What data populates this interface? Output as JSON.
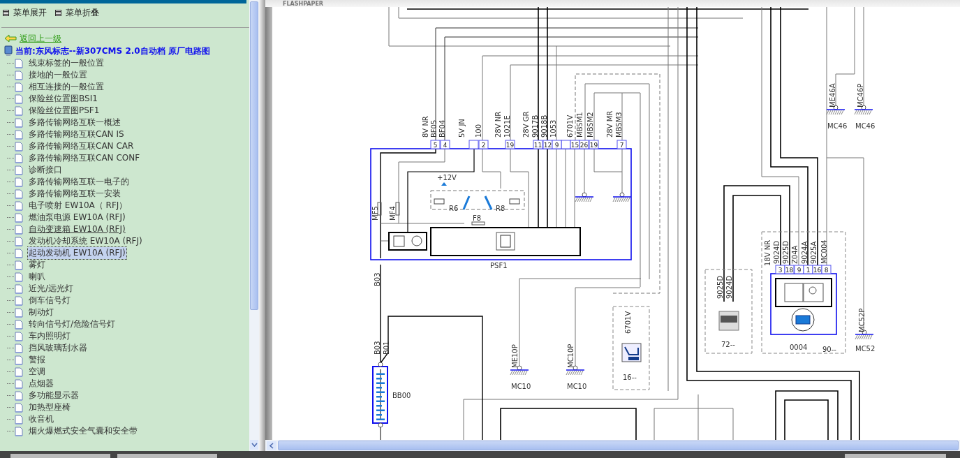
{
  "sidebar": {
    "expand_label": "菜单展开",
    "collapse_label": "菜单折叠",
    "back_link": "返回上一级",
    "current_title": "当前:东风标志--新307CMS 2.0自动档 原厂电路图",
    "items": [
      {
        "label": "线束标签的一般位置",
        "selected": false,
        "hovered": false
      },
      {
        "label": "接地的一般位置",
        "selected": false,
        "hovered": false
      },
      {
        "label": "相互连接的一般位置",
        "selected": false,
        "hovered": false
      },
      {
        "label": "保险丝位置图BSI1",
        "selected": false,
        "hovered": false
      },
      {
        "label": "保险丝位置图PSF1",
        "selected": false,
        "hovered": false
      },
      {
        "label": "多路传输网络互联一概述",
        "selected": false,
        "hovered": false
      },
      {
        "label": "多路传输网络互联CAN IS",
        "selected": false,
        "hovered": false
      },
      {
        "label": "多路传输网络互联CAN CAR",
        "selected": false,
        "hovered": false
      },
      {
        "label": "多路传输网络互联CAN CONF",
        "selected": false,
        "hovered": false
      },
      {
        "label": "诊断接口",
        "selected": false,
        "hovered": false
      },
      {
        "label": "多路传输网络互联一电子的",
        "selected": false,
        "hovered": false
      },
      {
        "label": "多路传输网络互联一安装",
        "selected": false,
        "hovered": false
      },
      {
        "label": "电子喷射 EW10A（ RFJ）",
        "selected": false,
        "hovered": false
      },
      {
        "label": "燃油泵电源 EW10A (RFJ)",
        "selected": false,
        "hovered": false
      },
      {
        "label": "自动变速箱 EW10A (RFJ)",
        "selected": false,
        "hovered": true
      },
      {
        "label": "发动机冷却系统 EW10A (RFJ)",
        "selected": false,
        "hovered": false
      },
      {
        "label": "起动发动机 EW10A (RFJ)",
        "selected": true,
        "hovered": false
      },
      {
        "label": "雾灯",
        "selected": false,
        "hovered": false
      },
      {
        "label": "喇叭",
        "selected": false,
        "hovered": false
      },
      {
        "label": "近光/远光灯",
        "selected": false,
        "hovered": false
      },
      {
        "label": "倒车信号灯",
        "selected": false,
        "hovered": false
      },
      {
        "label": "制动灯",
        "selected": false,
        "hovered": false
      },
      {
        "label": "转向信号灯/危险信号灯",
        "selected": false,
        "hovered": false
      },
      {
        "label": "车内照明灯",
        "selected": false,
        "hovered": false
      },
      {
        "label": "挡风玻璃刮水器",
        "selected": false,
        "hovered": false
      },
      {
        "label": "警报",
        "selected": false,
        "hovered": false
      },
      {
        "label": "空调",
        "selected": false,
        "hovered": false
      },
      {
        "label": "点烟器",
        "selected": false,
        "hovered": false
      },
      {
        "label": "多功能显示器",
        "selected": false,
        "hovered": false
      },
      {
        "label": "加热型座椅",
        "selected": false,
        "hovered": false
      },
      {
        "label": "收音机",
        "selected": false,
        "hovered": false
      },
      {
        "label": "烟火爆燃式安全气囊和安全带",
        "selected": false,
        "hovered": false
      }
    ]
  },
  "viewer": {
    "logo": "FLASHPAPER"
  },
  "diagram": {
    "labels": [
      {
        "text": "8V NR",
        "kind": "vertical"
      },
      {
        "text": "BF05",
        "kind": "vertical"
      },
      {
        "text": "BF04",
        "kind": "vertical"
      },
      {
        "text": "5V JN",
        "kind": "vertical"
      },
      {
        "text": "100",
        "kind": "vertical"
      },
      {
        "text": "28V NR",
        "kind": "vertical"
      },
      {
        "text": "1021E",
        "kind": "vertical"
      },
      {
        "text": "28V GR",
        "kind": "vertical"
      },
      {
        "text": "9017B",
        "kind": "vertical"
      },
      {
        "text": "9018B",
        "kind": "vertical"
      },
      {
        "text": "1053",
        "kind": "vertical"
      },
      {
        "text": "6701V",
        "kind": "vertical"
      },
      {
        "text": "MBSM1",
        "kind": "vertical"
      },
      {
        "text": "MBSM2",
        "kind": "vertical"
      },
      {
        "text": "28V MR",
        "kind": "vertical"
      },
      {
        "text": "MBSM3",
        "kind": "vertical"
      },
      {
        "text": "+12V",
        "kind": "horizontal"
      },
      {
        "text": "R6",
        "kind": "horizontal"
      },
      {
        "text": "R8",
        "kind": "horizontal"
      },
      {
        "text": "F8",
        "kind": "horizontal"
      },
      {
        "text": "MF5",
        "kind": "vertical"
      },
      {
        "text": "MF4",
        "kind": "vertical"
      },
      {
        "text": "PSF1",
        "kind": "horizontal"
      },
      {
        "text": "B03",
        "kind": "vertical"
      },
      {
        "text": "B03",
        "kind": "vertical"
      },
      {
        "text": "B01",
        "kind": "vertical"
      },
      {
        "text": "BB00",
        "kind": "horizontal"
      },
      {
        "text": "ME10P",
        "kind": "vertical"
      },
      {
        "text": "MC10",
        "kind": "horizontal"
      },
      {
        "text": "MC10P",
        "kind": "vertical"
      },
      {
        "text": "MC10",
        "kind": "horizontal"
      },
      {
        "text": "6701V",
        "kind": "vertical"
      },
      {
        "text": "16--",
        "kind": "horizontal"
      },
      {
        "text": "ME46A",
        "kind": "vertical"
      },
      {
        "text": "MC46",
        "kind": "horizontal"
      },
      {
        "text": "MC46P",
        "kind": "vertical"
      },
      {
        "text": "MC46",
        "kind": "horizontal"
      },
      {
        "text": "9025D",
        "kind": "vertical"
      },
      {
        "text": "9024D",
        "kind": "vertical"
      },
      {
        "text": "72--",
        "kind": "horizontal"
      },
      {
        "text": "18V NR",
        "kind": "vertical"
      },
      {
        "text": "9024D",
        "kind": "vertical"
      },
      {
        "text": "9025D",
        "kind": "vertical"
      },
      {
        "text": "Z04A",
        "kind": "vertical"
      },
      {
        "text": "9024A",
        "kind": "vertical"
      },
      {
        "text": "9025A",
        "kind": "vertical"
      },
      {
        "text": "MC004",
        "kind": "vertical"
      },
      {
        "text": "0004",
        "kind": "horizontal"
      },
      {
        "text": "90--",
        "kind": "horizontal"
      },
      {
        "text": "MC52P",
        "kind": "vertical"
      },
      {
        "text": "MC52",
        "kind": "horizontal"
      }
    ],
    "connectors": [
      {
        "pins": [
          "5",
          "4",
          "2",
          "19",
          "11",
          "12",
          "9",
          "15",
          "26",
          "19",
          "7"
        ]
      },
      {
        "pins": [
          "3",
          "18",
          "9",
          "1",
          "16",
          "8"
        ]
      }
    ]
  }
}
